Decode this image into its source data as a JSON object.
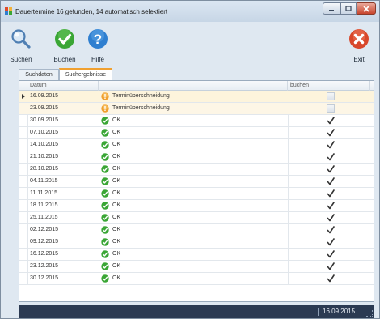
{
  "window": {
    "title": "Dauertermine 16 gefunden, 14 automatisch selektiert"
  },
  "toolbar": {
    "search_label": "Suchen",
    "book_label": "Buchen",
    "help_label": "Hilfe",
    "exit_label": "Exit"
  },
  "tabs": [
    {
      "label": "Suchdaten"
    },
    {
      "label": "Suchergebnisse",
      "active": true
    }
  ],
  "grid": {
    "columns": [
      "Datum",
      "",
      "buchen"
    ],
    "rows": [
      {
        "date": "16.09.2015",
        "status": "Terminüberschneidung",
        "status_type": "warning",
        "checked": false,
        "current": true
      },
      {
        "date": "23.09.2015",
        "status": "Terminüberschneidung",
        "status_type": "warning",
        "checked": false
      },
      {
        "date": "30.09.2015",
        "status": "OK",
        "status_type": "ok",
        "checked": true
      },
      {
        "date": "07.10.2015",
        "status": "OK",
        "status_type": "ok",
        "checked": true
      },
      {
        "date": "14.10.2015",
        "status": "OK",
        "status_type": "ok",
        "checked": true
      },
      {
        "date": "21.10.2015",
        "status": "OK",
        "status_type": "ok",
        "checked": true
      },
      {
        "date": "28.10.2015",
        "status": "OK",
        "status_type": "ok",
        "checked": true
      },
      {
        "date": "04.11.2015",
        "status": "OK",
        "status_type": "ok",
        "checked": true
      },
      {
        "date": "11.11.2015",
        "status": "OK",
        "status_type": "ok",
        "checked": true
      },
      {
        "date": "18.11.2015",
        "status": "OK",
        "status_type": "ok",
        "checked": true
      },
      {
        "date": "25.11.2015",
        "status": "OK",
        "status_type": "ok",
        "checked": true
      },
      {
        "date": "02.12.2015",
        "status": "OK",
        "status_type": "ok",
        "checked": true
      },
      {
        "date": "09.12.2015",
        "status": "OK",
        "status_type": "ok",
        "checked": true
      },
      {
        "date": "16.12.2015",
        "status": "OK",
        "status_type": "ok",
        "checked": true
      },
      {
        "date": "23.12.2015",
        "status": "OK",
        "status_type": "ok",
        "checked": true
      },
      {
        "date": "30.12.2015",
        "status": "OK",
        "status_type": "ok",
        "checked": true
      }
    ]
  },
  "statusbar": {
    "date": "16.09.2015"
  },
  "colors": {
    "ok_green": "#3aa635",
    "warning_orange": "#f0a030",
    "exit_red": "#d8472b",
    "help_blue": "#2f7fd0",
    "statusbar_bg": "#2b3a52"
  }
}
